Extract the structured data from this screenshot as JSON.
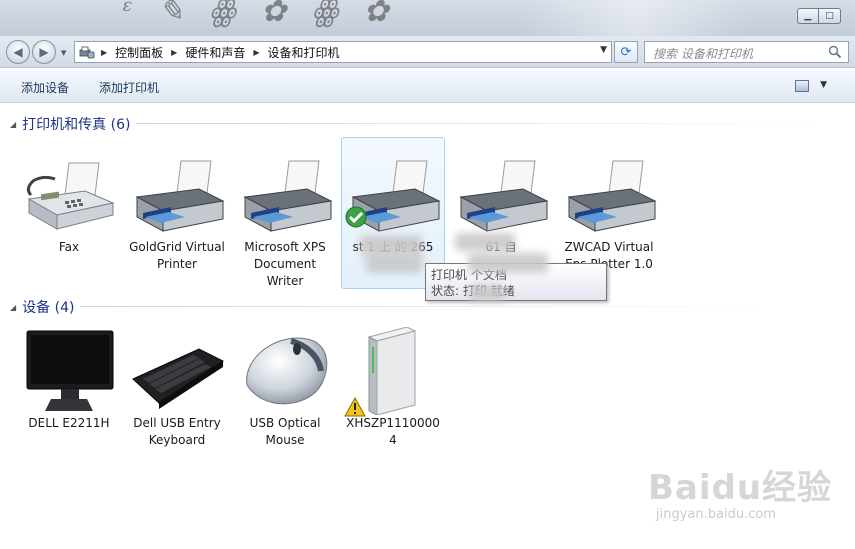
{
  "window": {
    "minimize_glyph": "▁",
    "maximize_glyph": "□"
  },
  "nav": {
    "back_glyph": "◀",
    "forward_glyph": "▶",
    "recent_glyph": "▼",
    "breadcrumbs": [
      "控制面板",
      "硬件和声音",
      "设备和打印机"
    ],
    "refresh_glyph": "⟳",
    "search_placeholder": "搜索 设备和打印机"
  },
  "toolbar": {
    "add_device": "添加设备",
    "add_printer": "添加打印机",
    "view_drop": "▼"
  },
  "groups": {
    "printers": {
      "title": "打印机和传真 (6)",
      "items": [
        {
          "label": "Fax"
        },
        {
          "label": "GoldGrid Virtual Printer"
        },
        {
          "label": "Microsoft XPS Document Writer"
        },
        {
          "label": "st        1 上 的       265",
          "default": true
        },
        {
          "label": "       61  自              "
        },
        {
          "label": "ZWCAD Virtual Eps Plotter 1.0"
        }
      ],
      "tooltip_line1": "打印机          个文档",
      "tooltip_line2": "状态: 打印        就绪"
    },
    "devices": {
      "title": "设备 (4)",
      "items": [
        {
          "label": "DELL E2211H"
        },
        {
          "label": "Dell USB Entry Keyboard"
        },
        {
          "label": "USB Optical Mouse"
        },
        {
          "label": "XHSZP11100004",
          "warning": true
        }
      ]
    }
  },
  "watermark": {
    "logo": "Baidu经验",
    "url": "jingyan.baidu.com"
  }
}
